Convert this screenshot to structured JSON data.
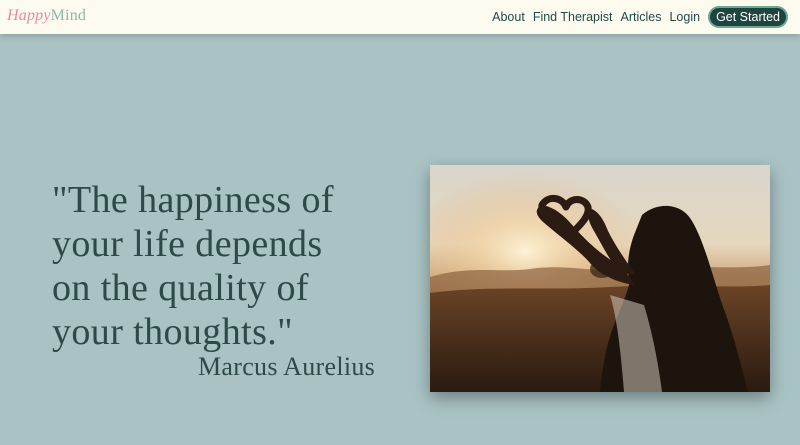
{
  "brand": {
    "part1": "Happy",
    "part2": "Mind"
  },
  "nav": {
    "items": [
      "About",
      "Find Therapist",
      "Articles",
      "Login"
    ],
    "cta_label": "Get Started"
  },
  "hero": {
    "quote_lines": [
      "\"The happiness of",
      "your life depends",
      "on the quality of",
      "your thoughts.\""
    ],
    "author": "Marcus Aurelius",
    "image_icon": "heart-hands-sunset-photo"
  },
  "colors": {
    "background": "#a9c3c4",
    "header": "#fdfbf0",
    "text": "#2c4a48",
    "cta_bg": "#1f4540",
    "brand_pink": "#e98a9d",
    "brand_green": "#8ab8aa"
  }
}
